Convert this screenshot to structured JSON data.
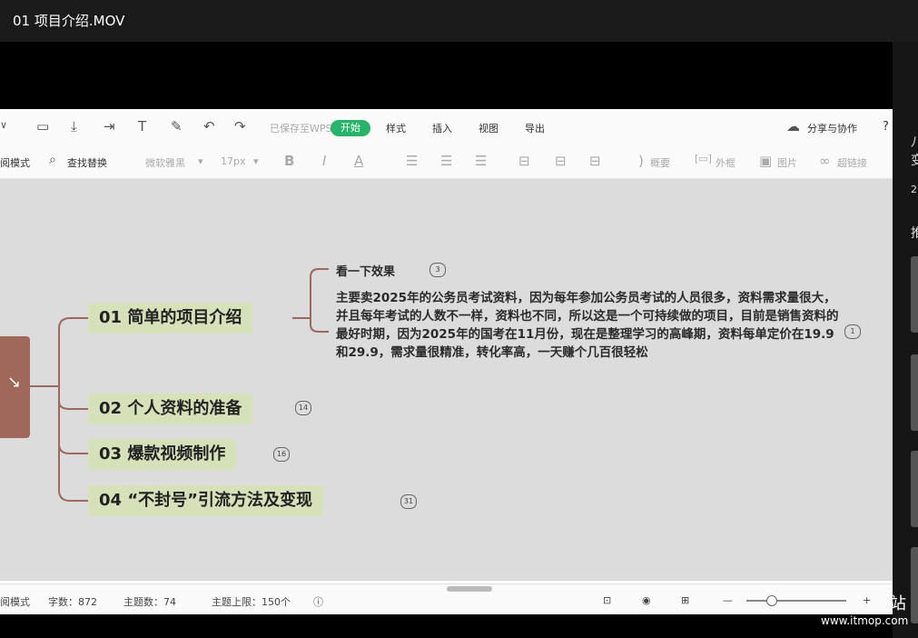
{
  "window": {
    "title": "01 项目介绍.MOV"
  },
  "toolbar1": {
    "saved": "已保存至WPS",
    "tabs": [
      "开始",
      "样式",
      "插入",
      "视图",
      "导出"
    ],
    "share": "分享与协作",
    "help": "?"
  },
  "toolbar2": {
    "mode": "阅模式",
    "find": "查找替换",
    "font": "微软雅黑",
    "size": "17px",
    "bold": "B",
    "italic": "I",
    "color": "A",
    "summary": "概要",
    "frame": "外框",
    "image": "图片",
    "link": "超链接"
  },
  "mindmap": {
    "root": "↘",
    "branches": [
      {
        "label": "01 简单的项目介绍"
      },
      {
        "label": "02 个人资料的准备",
        "count": "14"
      },
      {
        "label": "03 爆款视频制作",
        "count": "16"
      },
      {
        "label": "04 “不封号”引流方法及变现",
        "count": "31"
      }
    ],
    "sub1": {
      "label": "看一下效果",
      "count": "3"
    },
    "desc": {
      "text": "主要卖2025年的公务员考试资料，因为每年参加公务员考试的人员很多，资料需求量很大，并且每年考试的人数不一样，资料也不同，所以这是一个可持续做的项目，目前是销售资料的最好时期，因为2025年的国考在11月份，现在是整理学习的高峰期，资料每单定价在19.9和29.9，需求量很精准，转化率高，一天赚个几百很轻松",
      "count": "1"
    }
  },
  "statusbar": {
    "mode": "阅模式",
    "words": "字数：872",
    "topics": "主题数：74",
    "limit": "主题上限：150个"
  },
  "rightpanel": {
    "t1": "八",
    "t2": "变",
    "t3": "2",
    "t4": "推"
  },
  "watermark": {
    "char": "站",
    "url": "www.itmop.com"
  }
}
